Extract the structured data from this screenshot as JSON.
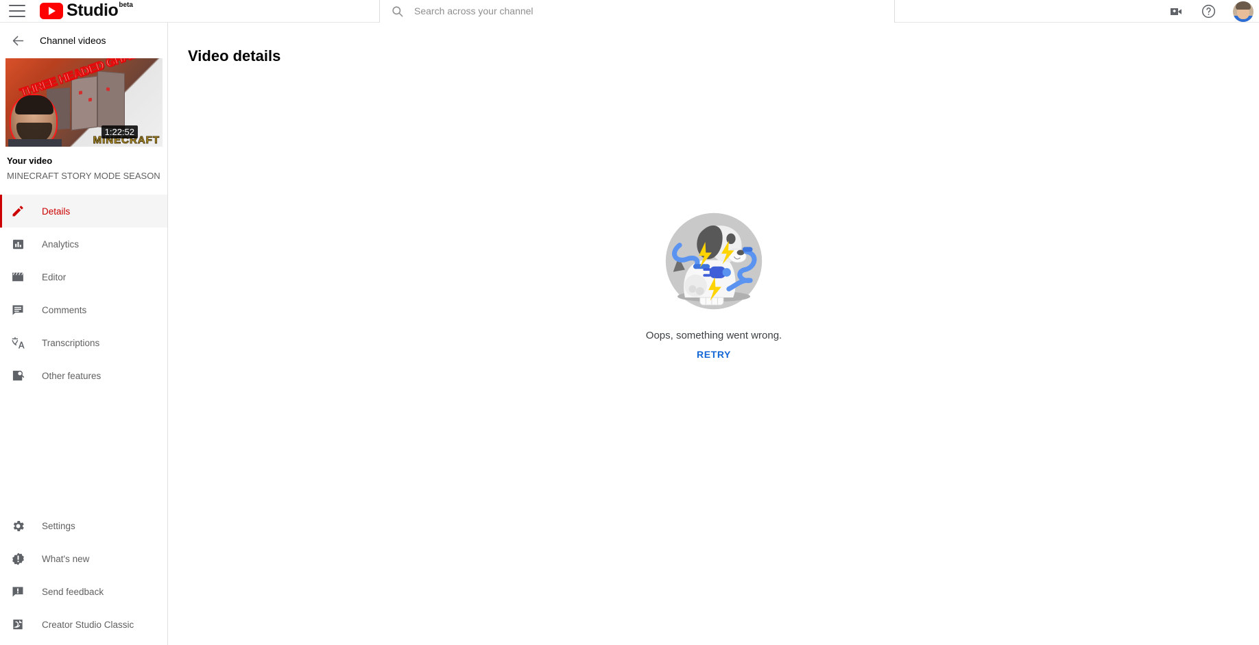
{
  "header": {
    "menu_icon": "hamburger-menu-icon",
    "brand_name": "Studio",
    "brand_badge": "beta",
    "search": {
      "placeholder": "Search across your channel",
      "value": "",
      "icon": "search-icon"
    },
    "create_icon": "video-camera-add-icon",
    "help_icon": "help-question-icon",
    "avatar": "user-avatar"
  },
  "sidebar": {
    "back_label": "Channel videos",
    "back_icon": "arrow-left-icon",
    "video": {
      "thumbnail_overlay_text": "THREE HEADED GHAST??!!",
      "thumbnail_brand_text": "MINECRAFT",
      "duration": "1:22:52",
      "label": "Your video",
      "title": "MINECRAFT STORY MODE SEASON …"
    },
    "items": [
      {
        "label": "Details",
        "icon": "pencil-edit-icon",
        "active": true
      },
      {
        "label": "Analytics",
        "icon": "bar-chart-icon",
        "active": false
      },
      {
        "label": "Editor",
        "icon": "clapperboard-icon",
        "active": false
      },
      {
        "label": "Comments",
        "icon": "comment-lines-icon",
        "active": false
      },
      {
        "label": "Transcriptions",
        "icon": "translate-icon",
        "active": false
      },
      {
        "label": "Other features",
        "icon": "page-search-icon",
        "active": false
      }
    ],
    "bottom_items": [
      {
        "label": "Settings",
        "icon": "gear-icon"
      },
      {
        "label": "What's new",
        "icon": "exclamation-badge-icon"
      },
      {
        "label": "Send feedback",
        "icon": "feedback-speech-icon"
      },
      {
        "label": "Creator Studio Classic",
        "icon": "creator-studio-classic-icon"
      }
    ]
  },
  "main": {
    "page_title": "Video details",
    "error": {
      "illustration": "broken-dog-cable-error-illustration",
      "message": "Oops, something went wrong.",
      "retry_label": "RETRY"
    }
  },
  "colors": {
    "brand_red": "#ff0000",
    "active_red": "#cc0000",
    "link_blue": "#1366d6",
    "text_primary": "#030303",
    "text_secondary": "#606060"
  }
}
